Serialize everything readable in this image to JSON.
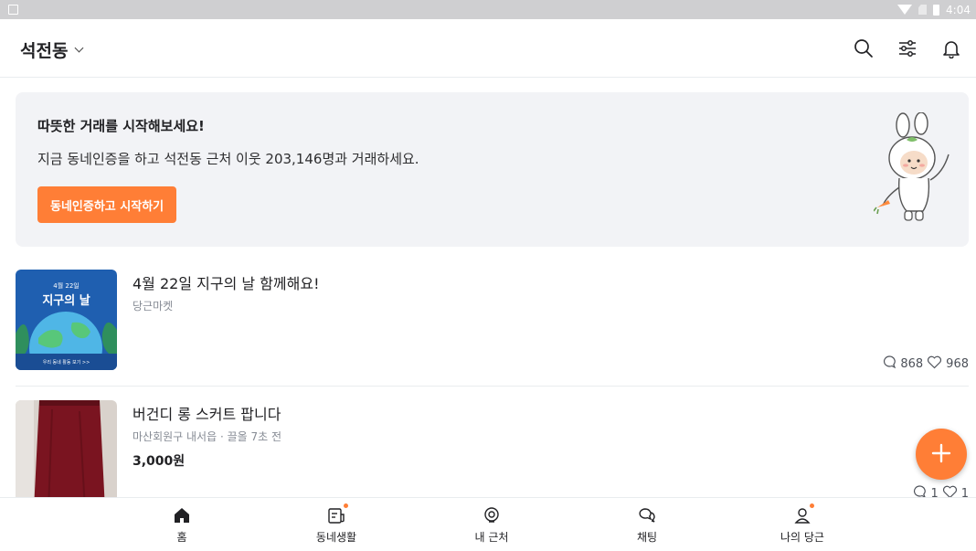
{
  "status_bar": {
    "time": "4:04"
  },
  "app_bar": {
    "location": "석전동",
    "icons": [
      "search-icon",
      "filter-icon",
      "bell-icon"
    ]
  },
  "banner": {
    "title": "따뜻한 거래를 시작해보세요!",
    "description": "지금 동네인증을 하고 석전동 근처 이웃 203,146명과 거래하세요.",
    "cta_label": "동네인증하고 시작하기"
  },
  "feed": [
    {
      "title": "4월 22일 지구의 날 함께해요!",
      "subtitle": "당근마켓",
      "price": "",
      "comments": "868",
      "likes": "968",
      "thumb_text": {
        "date": "4월 22일",
        "headline": "지구의 날",
        "footer": "우리 동네 활동 보기 >>"
      }
    },
    {
      "title": "버건디 롱 스커트 팝니다",
      "subtitle": "마산회원구 내서읍 · 끌올 7초 전",
      "price": "3,000원",
      "comments": "1",
      "likes": "1"
    }
  ],
  "fab": {
    "icon": "plus-icon"
  },
  "bottom_nav": [
    {
      "label": "홈",
      "icon": "home-icon",
      "badge": false
    },
    {
      "label": "동네생활",
      "icon": "neighborhood-icon",
      "badge": true
    },
    {
      "label": "내 근처",
      "icon": "location-pin-icon",
      "badge": false
    },
    {
      "label": "채팅",
      "icon": "chat-icon",
      "badge": false
    },
    {
      "label": "나의 당근",
      "icon": "profile-icon",
      "badge": true
    }
  ],
  "colors": {
    "accent": "#ff7e36",
    "banner_bg": "#f2f3f6",
    "text": "#212124",
    "muted": "#868b94"
  }
}
